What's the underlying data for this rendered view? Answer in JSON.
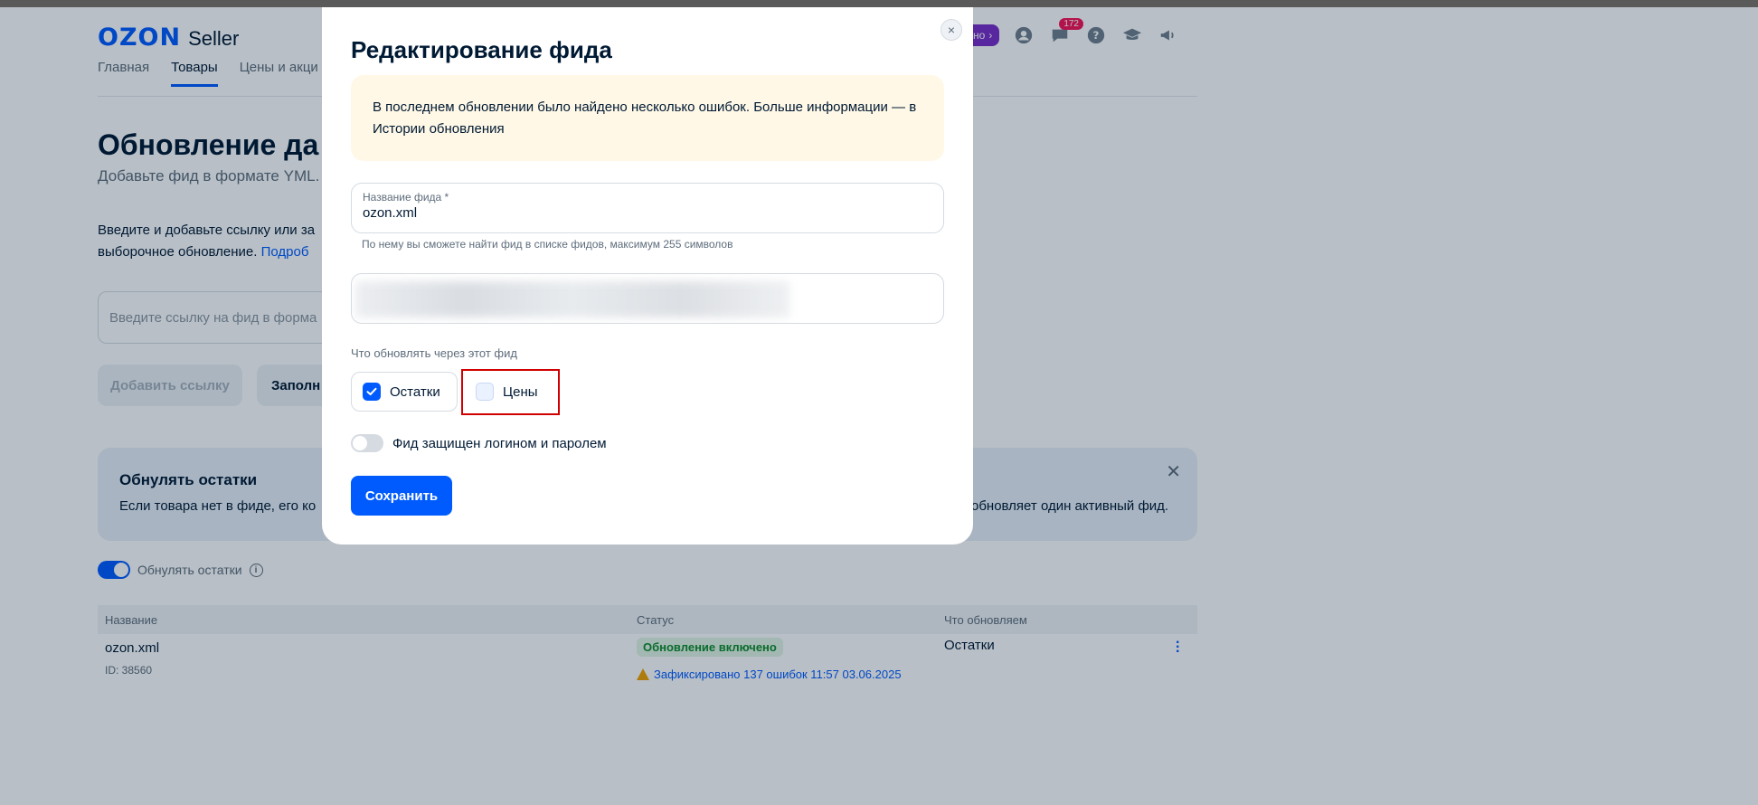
{
  "app": {
    "logo_mark": "OZON",
    "logo_sub": "Seller",
    "promo_text": "но",
    "messages_badge": "172"
  },
  "nav": {
    "items": [
      "Главная",
      "Товары",
      "Цены и акци"
    ]
  },
  "page": {
    "title": "Обновление да",
    "subtitle": "Добавьте фид в формате YML.",
    "desc_line1": "Введите и добавьте ссылку или за",
    "desc_line2": "выборочное обновление.",
    "desc_link": "Подроб",
    "url_placeholder": "Введите ссылку на фид в форма",
    "add_link_button": "Добавить ссылку",
    "fill_button": "Заполн"
  },
  "notice": {
    "title": "Обнулять остатки",
    "text_left": "Если товара нет в фиде, его ко",
    "text_right": "обновляет один активный фид."
  },
  "reset_toggle": {
    "label": "Обнулять остатки",
    "info": "i"
  },
  "table": {
    "headers": [
      "Название",
      "Статус",
      "Что обновляем"
    ],
    "rows": [
      {
        "name": "ozon.xml",
        "id": "ID: 38560",
        "status": "Обновление включено",
        "warning": "Зафиксировано 137 ошибок 11:57 03.06.2025",
        "what": "Остатки"
      }
    ]
  },
  "modal": {
    "title": "Редактирование фида",
    "close": "×",
    "alert_text": "В последнем обновлении было найдено несколько ошибок. Больше информации — в Истории обновления",
    "feed_name_label": "Название фида *",
    "feed_name_value": "ozon.xml",
    "feed_name_hint": "По нему вы сможете найти фид в списке фидов, максимум 255 символов",
    "update_label": "Что обновлять через этот фид",
    "checkbox_stock": "Остатки",
    "checkbox_stock_checked": true,
    "checkbox_prices": "Цены",
    "checkbox_prices_checked": false,
    "auth_toggle_label": "Фид защищен логином и паролем",
    "save_button": "Сохранить"
  },
  "colors": {
    "accent": "#005bff",
    "alert_bg": "#fff8e6",
    "highlight_frame": "#d10000",
    "status_ok": "#0f8c2b",
    "warning": "#f1a100"
  }
}
